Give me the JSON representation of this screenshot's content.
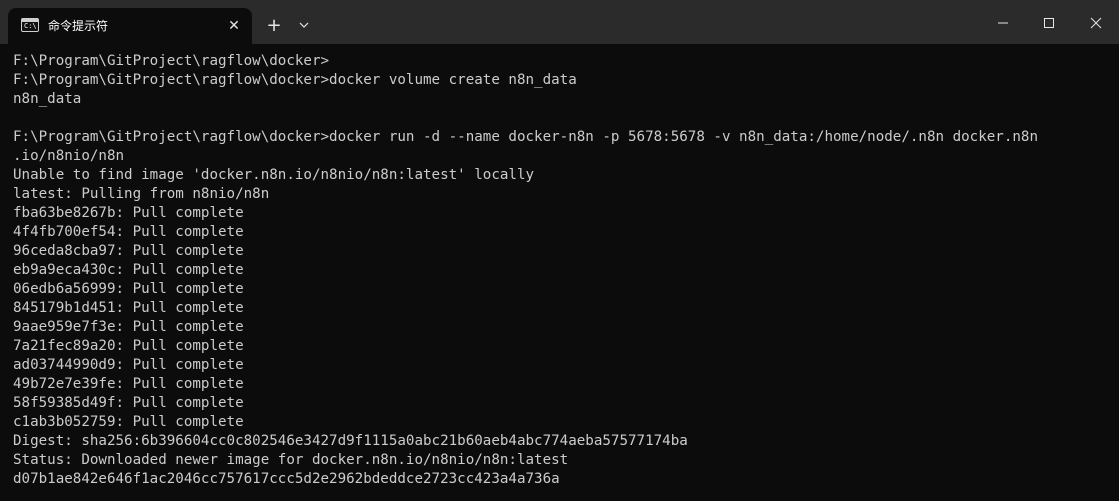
{
  "window": {
    "tab_title": "命令提示符",
    "tab_icon_glyph": "C:\\",
    "close_tab_symbol": "✕",
    "new_tab_symbol": "+",
    "dropdown_icon": "chevron-down-icon",
    "minimize_icon": "minimize-icon",
    "maximize_icon": "maximize-icon",
    "close_icon": "close-icon"
  },
  "colors": {
    "titlebar_bg": "#2b2b2b",
    "console_bg": "#0c0c0c",
    "console_fg": "#cccccc"
  },
  "console": {
    "lines": [
      "F:\\Program\\GitProject\\ragflow\\docker>",
      "F:\\Program\\GitProject\\ragflow\\docker>docker volume create n8n_data",
      "n8n_data",
      "",
      "F:\\Program\\GitProject\\ragflow\\docker>docker run -d --name docker-n8n -p 5678:5678 -v n8n_data:/home/node/.n8n docker.n8n",
      ".io/n8nio/n8n",
      "Unable to find image 'docker.n8n.io/n8nio/n8n:latest' locally",
      "latest: Pulling from n8nio/n8n",
      "fba63be8267b: Pull complete",
      "4f4fb700ef54: Pull complete",
      "96ceda8cba97: Pull complete",
      "eb9a9eca430c: Pull complete",
      "06edb6a56999: Pull complete",
      "845179b1d451: Pull complete",
      "9aae959e7f3e: Pull complete",
      "7a21fec89a20: Pull complete",
      "ad03744990d9: Pull complete",
      "49b72e7e39fe: Pull complete",
      "58f59385d49f: Pull complete",
      "c1ab3b052759: Pull complete",
      "Digest: sha256:6b396604cc0c802546e3427d9f1115a0abc21b60aeb4abc774aeba57577174ba",
      "Status: Downloaded newer image for docker.n8n.io/n8nio/n8n:latest",
      "d07b1ae842e646f1ac2046cc757617ccc5d2e2962bdeddce2723cc423a4a736a"
    ]
  }
}
